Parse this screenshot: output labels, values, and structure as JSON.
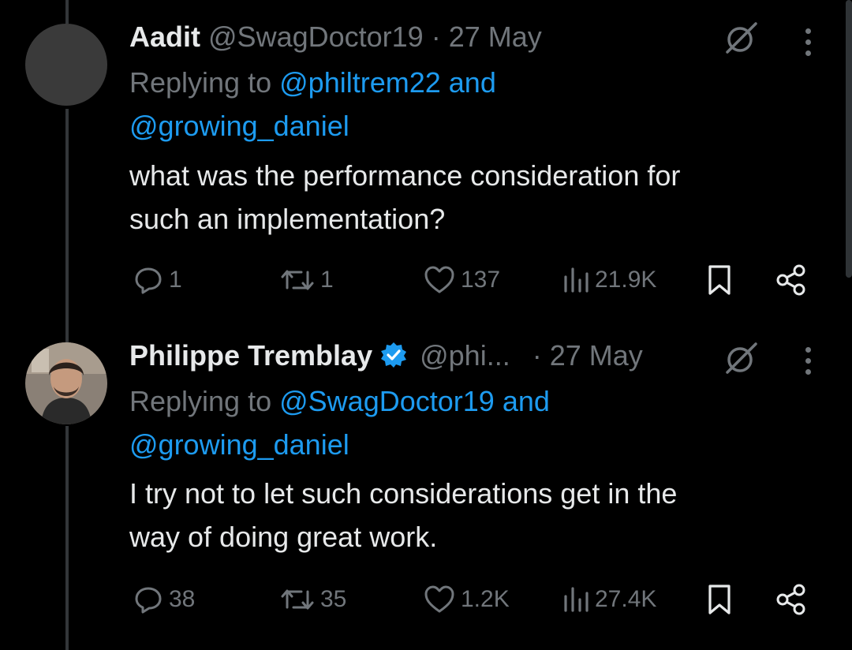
{
  "tweets": [
    {
      "name": "Aadit",
      "handle": "@SwagDoctor19",
      "separator": "·",
      "date": "27 May",
      "replying_prefix": "Replying to",
      "mention1": "@philtrem22",
      "and": "and",
      "mention2": "@growing_daniel",
      "text_line1": "what was the performance consideration for",
      "text_line2": "such an implementation?",
      "replies": "1",
      "reposts": "1",
      "likes": "137",
      "views": "21.9K",
      "verified": false
    },
    {
      "name": "Philippe Tremblay",
      "handle": "@phi...",
      "separator": "·",
      "date": "27 May",
      "replying_prefix": "Replying to",
      "mention1": "@SwagDoctor19",
      "and": "and",
      "mention2": "@growing_daniel",
      "text_line1": "I try not to let such considerations get in the",
      "text_line2": "way of doing great work.",
      "replies": "38",
      "reposts": "35",
      "likes": "1.2K",
      "views": "27.4K",
      "verified": true
    }
  ],
  "colors": {
    "background": "#000000",
    "text": "#e7e9ea",
    "muted": "#71767b",
    "accent": "#1d9bf0",
    "thread_line": "#333639"
  },
  "icons": [
    "reply-icon",
    "repost-icon",
    "like-icon",
    "views-icon",
    "bookmark-icon",
    "share-icon",
    "grok-icon",
    "more-icon",
    "verified-icon"
  ]
}
